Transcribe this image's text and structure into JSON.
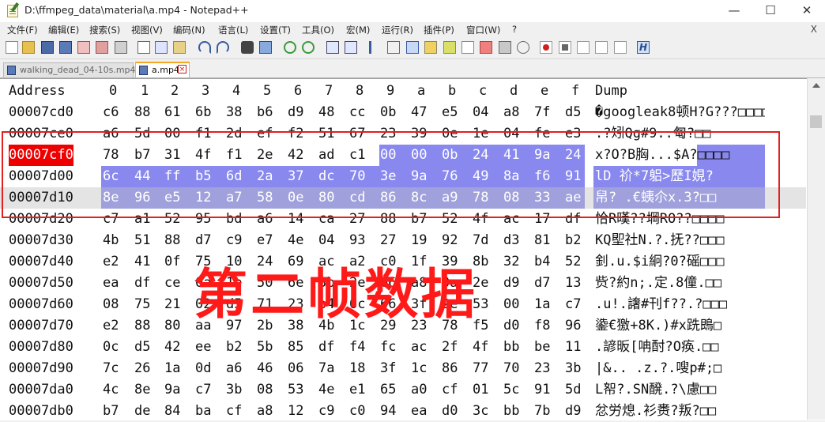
{
  "window": {
    "title": "D:\\ffmpeg_data\\material\\a.mp4 - Notepad++",
    "minimize": "—",
    "maximize": "☐",
    "close": "✕"
  },
  "menu": {
    "items": [
      "文件(F)",
      "编辑(E)",
      "搜索(S)",
      "视图(V)",
      "编码(N)",
      "语言(L)",
      "设置(T)",
      "工具(O)",
      "宏(M)",
      "运行(R)",
      "插件(P)",
      "窗口(W)",
      "?"
    ],
    "close_doc": "X"
  },
  "tabs": [
    {
      "label": "walking_dead_04-10s.mp4",
      "active": false
    },
    {
      "label": "a.mp4",
      "active": true
    }
  ],
  "hex": {
    "header": {
      "address": "Address",
      "columns": [
        "0",
        "1",
        "2",
        "3",
        "4",
        "5",
        "6",
        "7",
        "8",
        "9",
        "a",
        "b",
        "c",
        "d",
        "e",
        "f"
      ],
      "dump": "Dump"
    },
    "rows": [
      {
        "addr": "00007cd0",
        "bytes": [
          "c6",
          "88",
          "61",
          "6b",
          "38",
          "b6",
          "d9",
          "48",
          "cc",
          "0b",
          "47",
          "e5",
          "04",
          "a8",
          "7f",
          "d5"
        ],
        "dump": "�googleak8顿H?G???□□□□"
      },
      {
        "addr": "00007ce0",
        "bytes": [
          "a6",
          "5d",
          "00",
          "f1",
          "2d",
          "ef",
          "f2",
          "51",
          "67",
          "23",
          "39",
          "0e",
          "1e",
          "04",
          "fe",
          "e3"
        ],
        "dump": "  .?矧Qg#9..匎?□□"
      },
      {
        "addr": "00007cf0",
        "bytes": [
          "78",
          "b7",
          "31",
          "4f",
          "f1",
          "2e",
          "42",
          "ad",
          "c1",
          "00",
          "00",
          "0b",
          "24",
          "41",
          "9a",
          "24"
        ],
        "dump": "x?O?B胸...$A?□□□□"
      },
      {
        "addr": "00007d00",
        "bytes": [
          "6c",
          "44",
          "ff",
          "b5",
          "6d",
          "2a",
          "37",
          "dc",
          "70",
          "3e",
          "9a",
          "76",
          "49",
          "8a",
          "f6",
          "91"
        ],
        "dump": "lD  祄*7躳>歷I娊?"
      },
      {
        "addr": "00007d10",
        "bytes": [
          "8e",
          "96",
          "e5",
          "12",
          "a7",
          "58",
          "0e",
          "80",
          "cd",
          "86",
          "8c",
          "a9",
          "78",
          "08",
          "33",
          "ae"
        ],
        "dump": "帠?  .€蛦尒x.3?□□"
      },
      {
        "addr": "00007d20",
        "bytes": [
          "c7",
          "a1",
          "52",
          "95",
          "bd",
          "a6",
          "14",
          "ca",
          "27",
          "88",
          "b7",
          "52",
          "4f",
          "ac",
          "17",
          "df"
        ],
        "dump": "恰R暵??堈RO??□□□□"
      },
      {
        "addr": "00007d30",
        "bytes": [
          "4b",
          "51",
          "88",
          "d7",
          "c9",
          "e7",
          "4e",
          "04",
          "93",
          "27",
          "19",
          "92",
          "7d",
          "d3",
          "81",
          "b2"
        ],
        "dump": "KQ堲社N.?.抚??□□□"
      },
      {
        "addr": "00007d40",
        "bytes": [
          "e2",
          "41",
          "0f",
          "75",
          "10",
          "24",
          "69",
          "ac",
          "a2",
          "c0",
          "1f",
          "39",
          "8b",
          "32",
          "b4",
          "52"
        ],
        "dump": "釗.u.$i絅?0?磘□□□"
      },
      {
        "addr": "00007d50",
        "bytes": [
          "ea",
          "df",
          "ce",
          "0a",
          "1e",
          "50",
          "6e",
          "3b",
          "2e",
          "b6",
          "a8",
          "0a",
          "2e",
          "d9",
          "d7",
          "13"
        ],
        "dump": "赀?約n;.定.8僮.□□"
      },
      {
        "addr": "00007d60",
        "bytes": [
          "08",
          "75",
          "21",
          "02",
          "d5",
          "71",
          "23",
          "b4",
          "6c",
          "66",
          "3f",
          "2e",
          "53",
          "00",
          "1a",
          "c7"
        ],
        "dump": ".u!.譇#刊f??.?□□□"
      },
      {
        "addr": "00007d70",
        "bytes": [
          "e2",
          "88",
          "80",
          "aa",
          "97",
          "2b",
          "38",
          "4b",
          "1c",
          "29",
          "23",
          "78",
          "f5",
          "d0",
          "f8",
          "96"
        ],
        "dump": "鍌€獥+8K.)#x跣鵖□"
      },
      {
        "addr": "00007d80",
        "bytes": [
          "0c",
          "d5",
          "42",
          "ee",
          "b2",
          "5b",
          "85",
          "df",
          "f4",
          "fc",
          "ac",
          "2f",
          "4f",
          "bb",
          "be",
          "11"
        ],
        "dump": ".諺昄[呥酎?O痪.□□"
      },
      {
        "addr": "00007d90",
        "bytes": [
          "7c",
          "26",
          "1a",
          "0d",
          "a6",
          "46",
          "06",
          "7a",
          "18",
          "3f",
          "1c",
          "86",
          "77",
          "70",
          "23",
          "3b"
        ],
        "dump": "|&..  .z.?.嗖p#;□"
      },
      {
        "addr": "00007da0",
        "bytes": [
          "4c",
          "8e",
          "9a",
          "c7",
          "3b",
          "08",
          "53",
          "4e",
          "e1",
          "65",
          "a0",
          "cf",
          "01",
          "5c",
          "91",
          "5d"
        ],
        "dump": "L帤?.SN醗.?\\慮□□"
      },
      {
        "addr": "00007db0",
        "bytes": [
          "b7",
          "de",
          "84",
          "ba",
          "cf",
          "a8",
          "12",
          "c9",
          "c0",
          "94",
          "ea",
          "d0",
          "3c",
          "bb",
          "7b",
          "d9"
        ],
        "dump": "忿労熄.衫赉?叛?□□"
      }
    ]
  },
  "annotation": {
    "label": "第二帧数据",
    "color": "#ff1a1a"
  },
  "colors": {
    "selection": "#8888ee",
    "selection_dim": "#a0a0dd",
    "address_highlight": "#ee0000",
    "tab_accent": "#f5a623"
  }
}
